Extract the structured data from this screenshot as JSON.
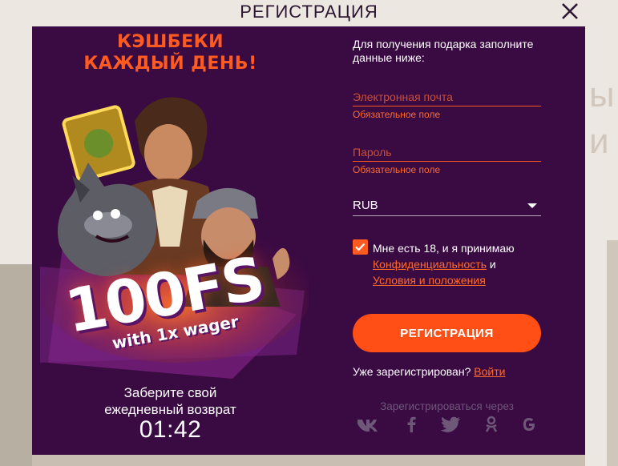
{
  "header": {
    "title": "РЕГИСТРАЦИЯ"
  },
  "promo": {
    "headline_line1": "КЭШБЕКИ",
    "headline_line2": "КАЖДЫЙ ДЕНЬ!",
    "bonus": "100FS",
    "wager": "with 1x wager",
    "caption_line1": "Заберите свой",
    "caption_line2": "ежедневный возврат",
    "timer": "01:42"
  },
  "form": {
    "intro": "Для получения подарка заполните данные ниже:",
    "email": {
      "placeholder": "Электронная почта",
      "value": "",
      "error": "Обязательное поле"
    },
    "password": {
      "placeholder": "Пароль",
      "value": "",
      "error": "Обязательное поле"
    },
    "currency": {
      "selected": "RUB"
    },
    "consent": {
      "checked": true,
      "text_before": "Мне есть 18, и я принимаю",
      "privacy_link": "Конфиденциальность",
      "and": "и",
      "terms_link": "Условия и положения"
    },
    "submit_label": "РЕГИСТРАЦИЯ",
    "login_prompt": "Уже зарегистрирован?",
    "login_link": "Войти",
    "social_title": "Зарегистрироваться через",
    "social_icons": [
      "vk-icon",
      "facebook-icon",
      "twitter-icon",
      "odnoklassniki-icon",
      "google-icon"
    ]
  },
  "colors": {
    "modal_bg": "#3a0a43",
    "accent": "#ff5a1f",
    "link": "#ff6a2a",
    "muted": "#6e5878"
  }
}
